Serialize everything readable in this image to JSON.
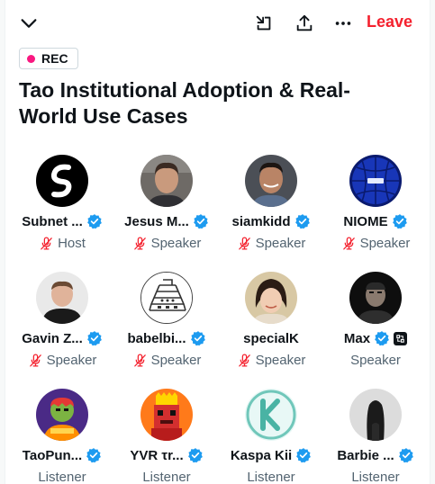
{
  "header": {
    "leave_label": "Leave",
    "icons": [
      "chevron-down-icon",
      "minimize-icon",
      "share-icon",
      "more-icon"
    ]
  },
  "recording": {
    "label": "REC",
    "dot_color": "#f91880"
  },
  "space": {
    "title": "Tao Institutional Adoption & Real-World Use Cases"
  },
  "participants": [
    {
      "name": "Subnet ...",
      "role": "Host",
      "verified": true,
      "muted": true
    },
    {
      "name": "Jesus M...",
      "role": "Speaker",
      "verified": true,
      "muted": true
    },
    {
      "name": "siamkidd",
      "role": "Speaker",
      "verified": true,
      "muted": true
    },
    {
      "name": "NIOME",
      "role": "Speaker",
      "verified": true,
      "muted": true
    },
    {
      "name": "Gavin Z...",
      "role": "Speaker",
      "verified": true,
      "muted": true
    },
    {
      "name": "babelbi...",
      "role": "Speaker",
      "verified": true,
      "muted": true
    },
    {
      "name": "specialK",
      "role": "Speaker",
      "verified": false,
      "muted": true
    },
    {
      "name": "Max",
      "role": "Speaker",
      "verified": true,
      "muted": false
    },
    {
      "name": "TaoPun...",
      "role": "Listener",
      "verified": true,
      "muted": false
    },
    {
      "name": "YVR τr...",
      "role": "Listener",
      "verified": true,
      "muted": false
    },
    {
      "name": "Kaspa Kii",
      "role": "Listener",
      "verified": true,
      "muted": false
    },
    {
      "name": "Barbie ...",
      "role": "Listener",
      "verified": true,
      "muted": false
    }
  ],
  "colors": {
    "accent_red": "#f4212e",
    "verified_blue": "#1d9bf0",
    "muted_mic": "#f4212e",
    "secondary_text": "#536471"
  }
}
